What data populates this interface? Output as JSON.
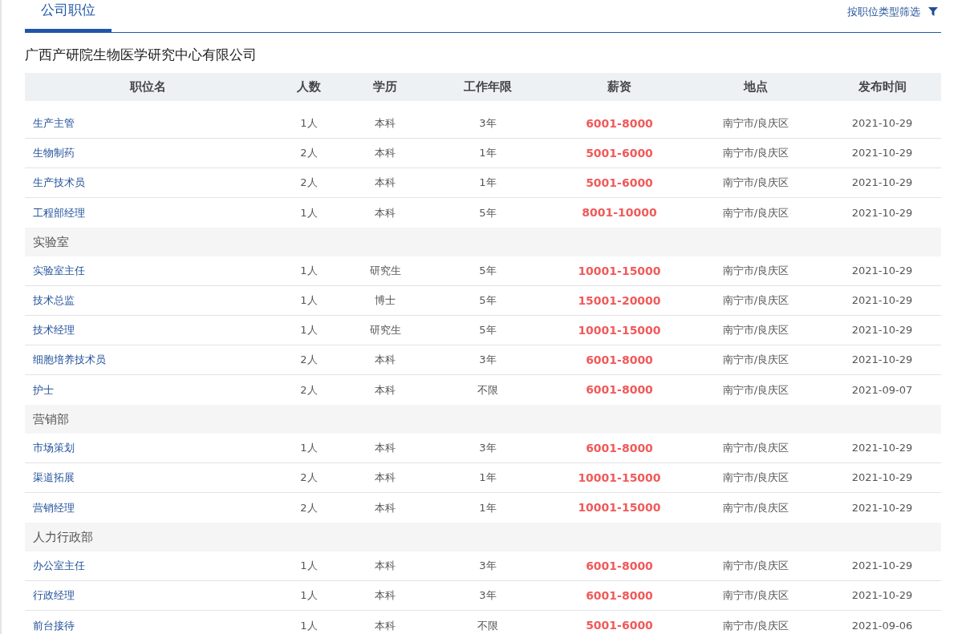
{
  "tab": {
    "label": "公司职位",
    "selected": true
  },
  "filter": {
    "label": "按职位类型筛选"
  },
  "company": "广西产研院生物医学研究中心有限公司",
  "table": {
    "columns": [
      "职位名",
      "人数",
      "学历",
      "工作年限",
      "薪资",
      "地点",
      "发布时间"
    ],
    "groups": [
      {
        "rows": [
          {
            "title": "生产主管",
            "count": "1人",
            "education": "本科",
            "years": "3年",
            "salary": "6001-8000",
            "location": "南宁市/良庆区",
            "date": "2021-10-29"
          },
          {
            "title": "生物制药",
            "count": "2人",
            "education": "本科",
            "years": "1年",
            "salary": "5001-6000",
            "location": "南宁市/良庆区",
            "date": "2021-10-29"
          },
          {
            "title": "生产技术员",
            "count": "2人",
            "education": "本科",
            "years": "1年",
            "salary": "5001-6000",
            "location": "南宁市/良庆区",
            "date": "2021-10-29"
          },
          {
            "title": "工程部经理",
            "count": "1人",
            "education": "本科",
            "years": "5年",
            "salary": "8001-10000",
            "location": "南宁市/良庆区",
            "date": "2021-10-29"
          }
        ]
      },
      {
        "name": "实验室",
        "rows": [
          {
            "title": "实验室主任",
            "count": "1人",
            "education": "研究生",
            "years": "5年",
            "salary": "10001-15000",
            "location": "南宁市/良庆区",
            "date": "2021-10-29"
          },
          {
            "title": "技术总监",
            "count": "1人",
            "education": "博士",
            "years": "5年",
            "salary": "15001-20000",
            "location": "南宁市/良庆区",
            "date": "2021-10-29"
          },
          {
            "title": "技术经理",
            "count": "1人",
            "education": "研究生",
            "years": "5年",
            "salary": "10001-15000",
            "location": "南宁市/良庆区",
            "date": "2021-10-29"
          },
          {
            "title": "细胞培养技术员",
            "count": "2人",
            "education": "本科",
            "years": "3年",
            "salary": "6001-8000",
            "location": "南宁市/良庆区",
            "date": "2021-10-29"
          },
          {
            "title": "护士",
            "count": "2人",
            "education": "本科",
            "years": "不限",
            "salary": "6001-8000",
            "location": "南宁市/良庆区",
            "date": "2021-09-07"
          }
        ]
      },
      {
        "name": "营销部",
        "rows": [
          {
            "title": "市场策划",
            "count": "1人",
            "education": "本科",
            "years": "3年",
            "salary": "6001-8000",
            "location": "南宁市/良庆区",
            "date": "2021-10-29"
          },
          {
            "title": "渠道拓展",
            "count": "2人",
            "education": "本科",
            "years": "1年",
            "salary": "10001-15000",
            "location": "南宁市/良庆区",
            "date": "2021-10-29"
          },
          {
            "title": "营销经理",
            "count": "2人",
            "education": "本科",
            "years": "1年",
            "salary": "10001-15000",
            "location": "南宁市/良庆区",
            "date": "2021-10-29"
          }
        ]
      },
      {
        "name": "人力行政部",
        "rows": [
          {
            "title": "办公室主任",
            "count": "1人",
            "education": "本科",
            "years": "3年",
            "salary": "6001-8000",
            "location": "南宁市/良庆区",
            "date": "2021-10-29"
          },
          {
            "title": "行政经理",
            "count": "1人",
            "education": "本科",
            "years": "3年",
            "salary": "6001-8000",
            "location": "南宁市/良庆区",
            "date": "2021-10-29"
          },
          {
            "title": "前台接待",
            "count": "1人",
            "education": "本科",
            "years": "不限",
            "salary": "5001-6000",
            "location": "南宁市/良庆区",
            "date": "2021-09-06"
          }
        ]
      }
    ]
  }
}
